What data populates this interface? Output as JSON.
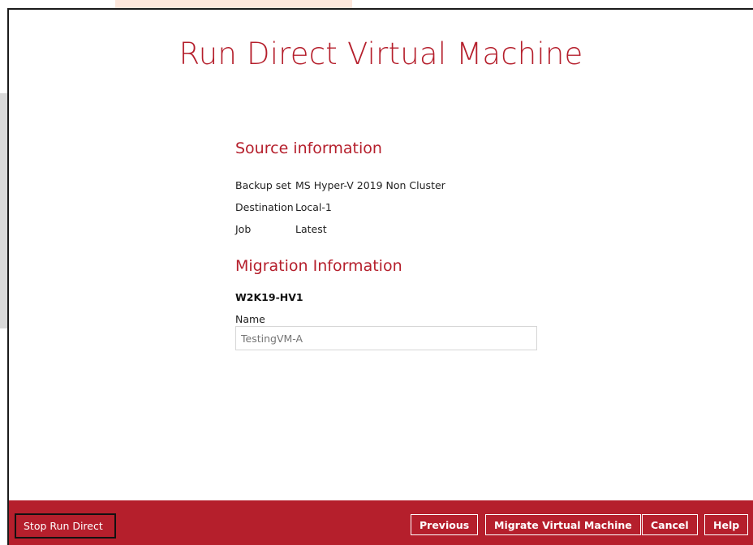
{
  "dialog": {
    "title": "Run Direct Virtual Machine"
  },
  "source": {
    "heading": "Source information",
    "rows": [
      {
        "key": "Backup set",
        "value": "MS Hyper-V 2019 Non Cluster"
      },
      {
        "key": "Destination",
        "value": "Local-1"
      },
      {
        "key": "Job",
        "value": "Latest"
      }
    ]
  },
  "migration": {
    "heading": "Migration Information",
    "host": "W2K19-HV1",
    "name_label": "Name",
    "name_placeholder": "TestingVM-A"
  },
  "footer": {
    "stop_label": "Stop Run Direct",
    "previous_label": "Previous",
    "migrate_label": "Migrate Virtual Machine",
    "cancel_label": "Cancel",
    "help_label": "Help"
  },
  "colors": {
    "accent": "#b51f2c",
    "text": "#222222",
    "input_border": "#d6d6d6"
  }
}
